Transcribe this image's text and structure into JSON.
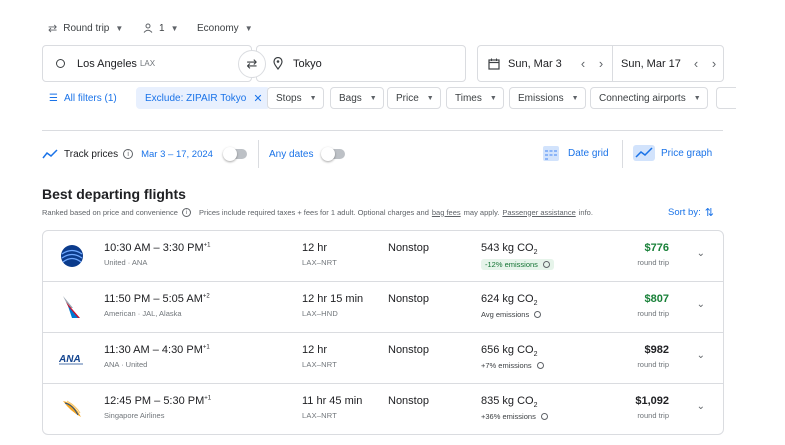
{
  "search": {
    "trip_type": "Round trip",
    "passengers": "1",
    "cabin": "Economy",
    "origin": "Los Angeles",
    "origin_code": "LAX",
    "destination": "Tokyo",
    "depart_date": "Sun, Mar 3",
    "return_date": "Sun, Mar 17"
  },
  "filters": {
    "all_filters": "All filters (1)",
    "exclude": "Exclude: ZIPAIR Tokyo",
    "stops": "Stops",
    "bags": "Bags",
    "price": "Price",
    "times": "Times",
    "emissions": "Emissions",
    "connecting": "Connecting airports"
  },
  "tracking": {
    "label": "Track prices",
    "dates": "Mar 3 – 17, 2024",
    "any_dates": "Any dates",
    "date_grid": "Date grid",
    "price_graph": "Price graph"
  },
  "results": {
    "heading": "Best departing flights",
    "ranked": "Ranked based on price and convenience",
    "prices_note": "Prices include required taxes + fees for 1 adult. Optional charges and",
    "bag_fees": "bag fees",
    "may_apply": "may apply.",
    "passenger_assistance": "Passenger assistance",
    "info": "info.",
    "sort_by": "Sort by:"
  },
  "flights": [
    {
      "airline_logo": "united-logo",
      "time": "10:30 AM – 3:30 PM",
      "day_offset": "+1",
      "airlines": "United · ANA",
      "duration": "12 hr",
      "route": "LAX–NRT",
      "stops": "Nonstop",
      "co2": "543 kg CO",
      "co2_sub": "2",
      "emissions": "-12% emissions",
      "price": "$776",
      "price_type": "round trip"
    },
    {
      "airline_logo": "american-logo",
      "time": "11:50 PM – 5:05 AM",
      "day_offset": "+2",
      "airlines": "American · JAL, Alaska",
      "duration": "12 hr 15 min",
      "route": "LAX–HND",
      "stops": "Nonstop",
      "co2": "624 kg CO",
      "co2_sub": "2",
      "emissions": "Avg emissions",
      "price": "$807",
      "price_type": "round trip"
    },
    {
      "airline_logo": "ana-logo",
      "time": "11:30 AM – 4:30 PM",
      "day_offset": "+1",
      "airlines": "ANA · United",
      "duration": "12 hr",
      "route": "LAX–NRT",
      "stops": "Nonstop",
      "co2": "656 kg CO",
      "co2_sub": "2",
      "emissions": "+7% emissions",
      "price": "$982",
      "price_type": "round trip"
    },
    {
      "airline_logo": "singapore-logo",
      "time": "12:45 PM – 5:30 PM",
      "day_offset": "+1",
      "airlines": "Singapore Airlines",
      "duration": "11 hr 45 min",
      "route": "LAX–NRT",
      "stops": "Nonstop",
      "co2": "835 kg CO",
      "co2_sub": "2",
      "emissions": "+36% emissions",
      "price": "$1,092",
      "price_type": "round trip"
    }
  ],
  "colors": {
    "accent": "#1a73e8",
    "price_green": "#188038",
    "emission_green_bg": "#e6f4ea",
    "border": "#dadce0"
  }
}
